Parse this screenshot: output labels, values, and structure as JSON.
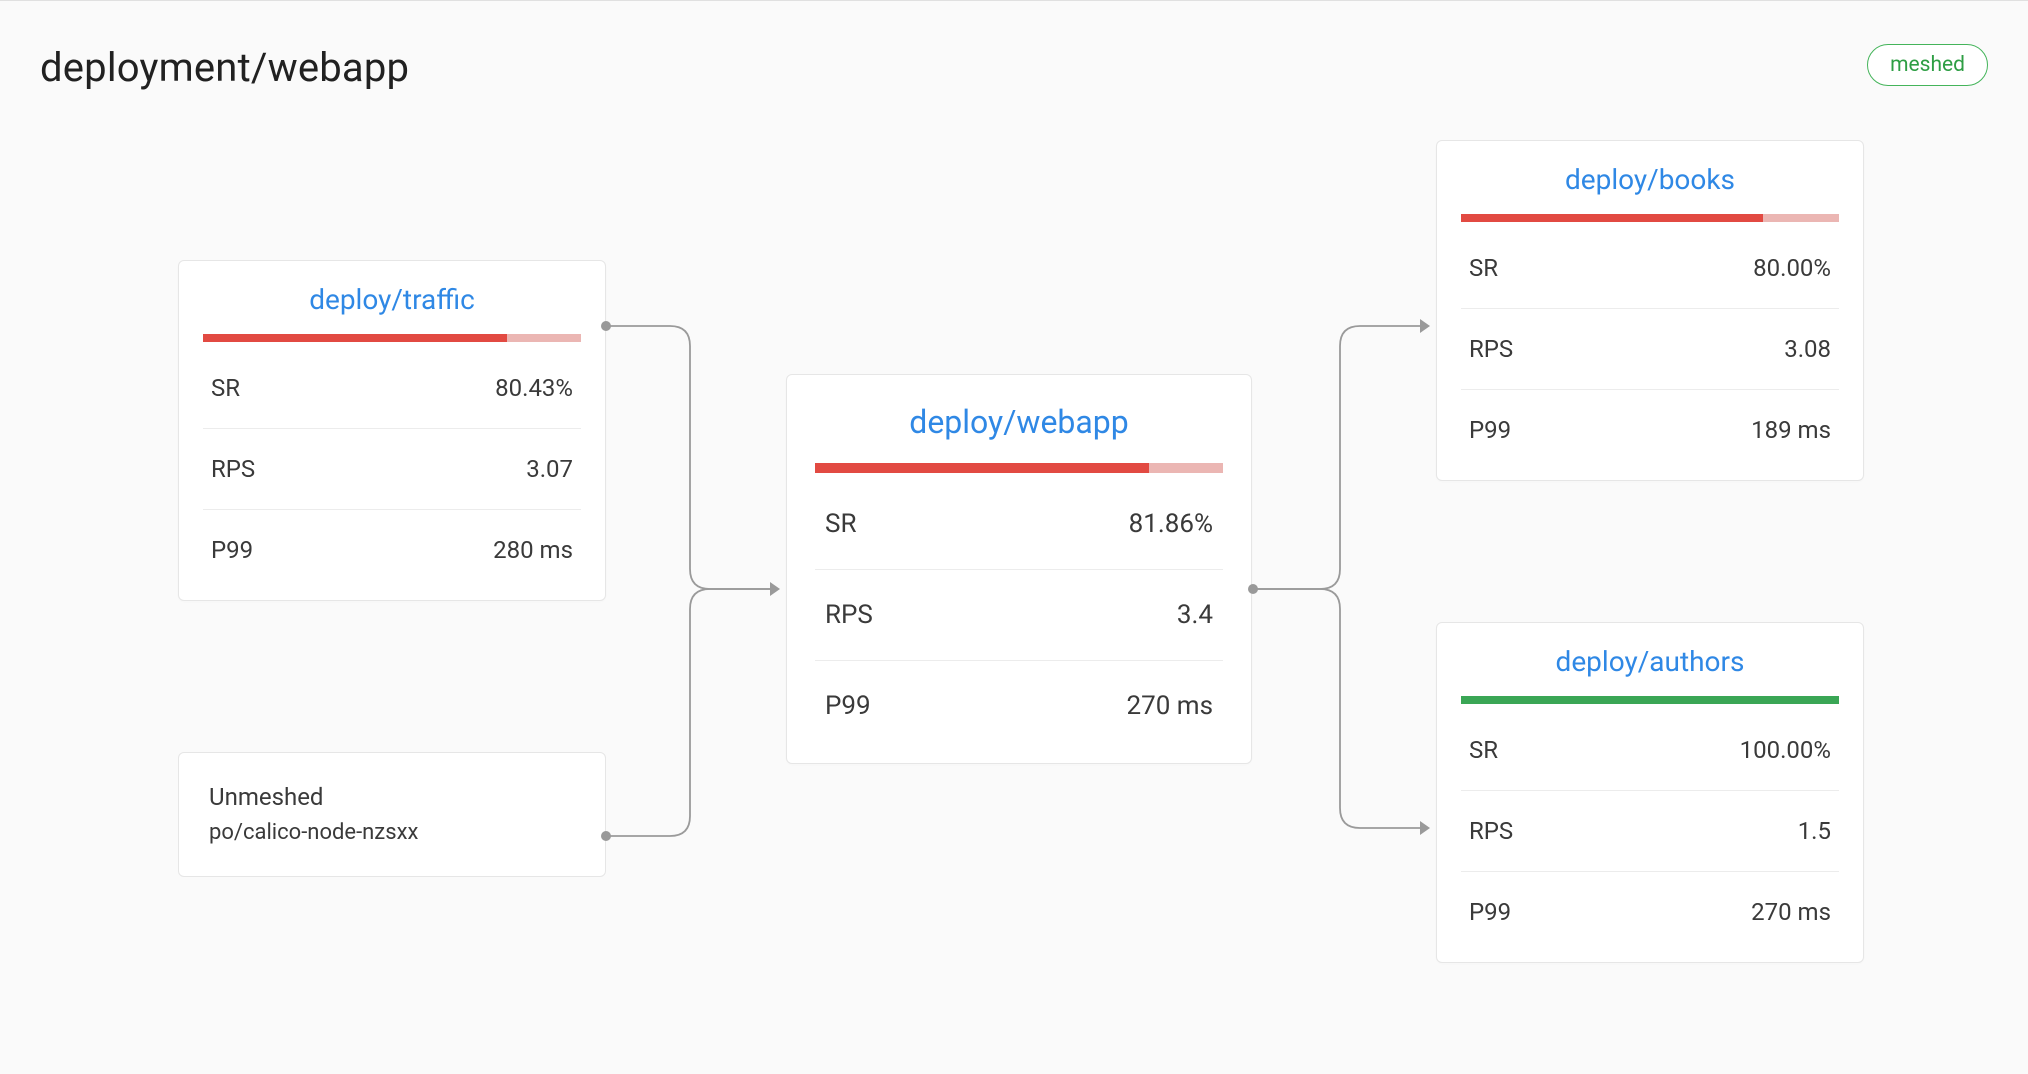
{
  "header": {
    "title": "deployment/webapp",
    "badge": "meshed"
  },
  "metric_labels": {
    "sr": "SR",
    "rps": "RPS",
    "p99": "P99"
  },
  "colors": {
    "red": "#e24a42",
    "green": "#3aa655",
    "link_blue": "#2f88e5"
  },
  "nodes": {
    "traffic": {
      "title": "deploy/traffic",
      "bar_class": "red",
      "bar_pct": "80.43%",
      "sr": "80.43%",
      "rps": "3.07",
      "p99": "280 ms"
    },
    "unmeshed": {
      "title": "Unmeshed",
      "subtitle": "po/calico-node-nzsxx"
    },
    "webapp": {
      "title": "deploy/webapp",
      "bar_class": "red",
      "bar_pct": "81.86%",
      "sr": "81.86%",
      "rps": "3.4",
      "p99": "270 ms"
    },
    "books": {
      "title": "deploy/books",
      "bar_class": "red",
      "bar_pct": "80%",
      "sr": "80.00%",
      "rps": "3.08",
      "p99": "189 ms"
    },
    "authors": {
      "title": "deploy/authors",
      "bar_class": "green",
      "bar_pct": "100%",
      "sr": "100.00%",
      "rps": "1.5",
      "p99": "270 ms"
    }
  }
}
